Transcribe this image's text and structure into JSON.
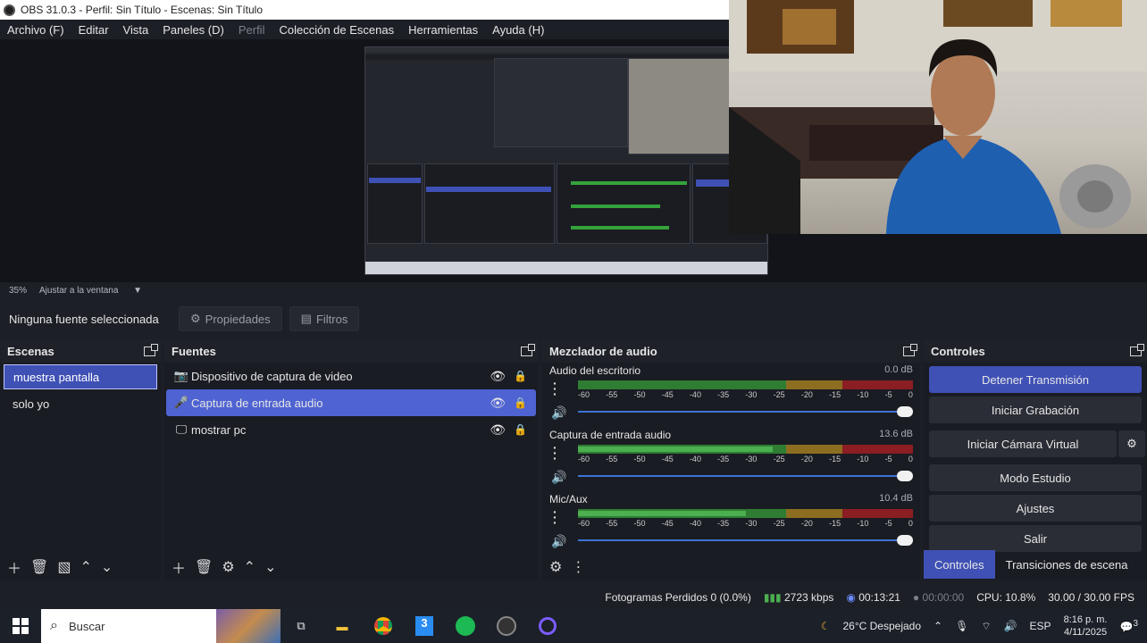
{
  "window": {
    "title": "OBS 31.0.3 - Perfil: Sin Título - Escenas: Sin Título"
  },
  "menu": [
    "Archivo (F)",
    "Editar",
    "Vista",
    "Paneles (D)",
    "Perfil",
    "Colección de Escenas",
    "Herramientas",
    "Ayuda (H)"
  ],
  "preview": {
    "zoom": "35%",
    "fit": "Ajustar a la ventana"
  },
  "properties": {
    "no_source": "Ninguna fuente seleccionada",
    "properties_label": "Propiedades",
    "filters_label": "Filtros"
  },
  "scenes": {
    "title": "Escenas",
    "items": [
      "muestra pantalla",
      "solo yo"
    ],
    "selected": 0
  },
  "sources": {
    "title": "Fuentes",
    "items": [
      {
        "label": "Dispositivo de captura de video",
        "icon": "camera-icon"
      },
      {
        "label": "Captura de entrada audio",
        "icon": "microphone-icon"
      },
      {
        "label": "mostrar pc",
        "icon": "monitor-icon"
      }
    ],
    "selected": 1
  },
  "mixer": {
    "title": "Mezclador de audio",
    "scale": [
      "-60",
      "-55",
      "-50",
      "-45",
      "-40",
      "-35",
      "-30",
      "-25",
      "-20",
      "-15",
      "-10",
      "-5",
      "0"
    ],
    "channels": [
      {
        "name": "Audio del escritorio",
        "db": "0.0 dB",
        "level": 0.0
      },
      {
        "name": "Captura de entrada audio",
        "db": "13.6 dB",
        "level": 0.58
      },
      {
        "name": "Mic/Aux",
        "db": "10.4 dB",
        "level": 0.5
      }
    ]
  },
  "controls": {
    "title": "Controles",
    "stop_stream": "Detener Transmisión",
    "start_recording": "Iniciar Grabación",
    "start_virtual_cam": "Iniciar Cámara Virtual",
    "studio_mode": "Modo Estudio",
    "settings": "Ajustes",
    "exit": "Salir",
    "tab_controls": "Controles",
    "tab_transitions": "Transiciones de escena"
  },
  "status": {
    "dropped_frames": "Fotogramas Perdidos 0 (0.0%)",
    "bitrate": "2723 kbps",
    "stream_time": "00:13:21",
    "record_time": "00:00:00",
    "cpu": "CPU: 10.8%",
    "fps": "30.00 / 30.00 FPS"
  },
  "taskbar": {
    "search": "Buscar",
    "weather": "26°C  Despejado",
    "lang": "ESP",
    "time": "8:16 p. m.",
    "date": "4/11/2025",
    "notifications": "3"
  }
}
